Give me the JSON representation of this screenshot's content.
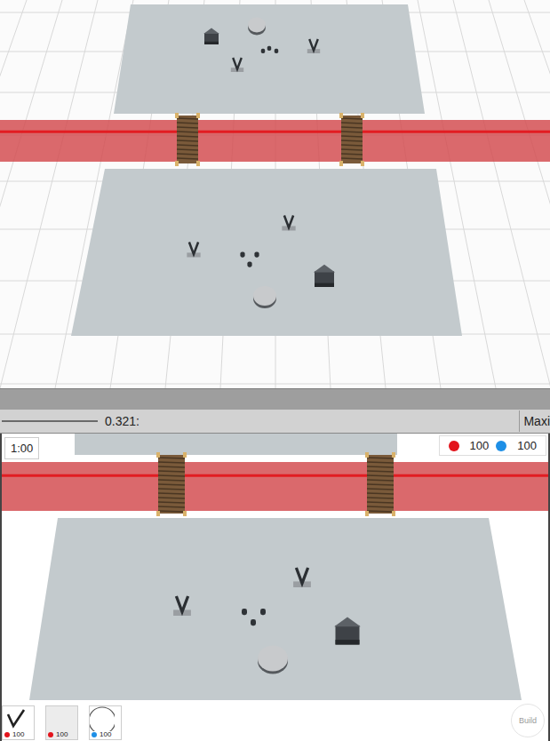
{
  "toolbar": {
    "slider_value": "0.321:",
    "maximize": "Maxi"
  },
  "hud": {
    "timer": "1:00",
    "scores": [
      {
        "value": "100",
        "color": "#e3141c"
      },
      {
        "value": "100",
        "color": "#1e8fe6"
      }
    ]
  },
  "cards": [
    {
      "kind": "tower",
      "cost": "100",
      "color": "#e3141c"
    },
    {
      "kind": "wall",
      "cost": "100",
      "color": "#e3141c"
    },
    {
      "kind": "disk",
      "cost": "100",
      "color": "#1e8fe6"
    }
  ],
  "build_button": {
    "label": "Build"
  }
}
